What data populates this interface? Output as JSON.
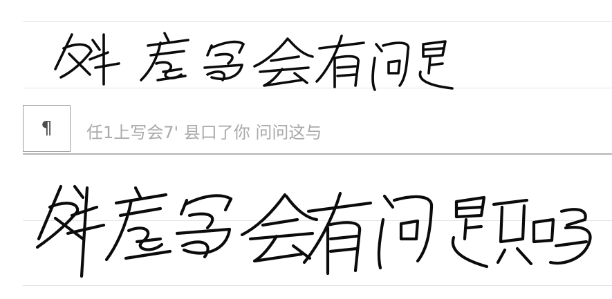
{
  "editor": {
    "ink_color": "#0b0b0b",
    "rule_color": "#e3e3e3",
    "handwriting_line_1": "斜着写会有问题",
    "handwriting_line_2": "斜着写会有问题吗"
  },
  "recognition_bar": {
    "paragraph_icon": "pilcrow-icon",
    "paragraph_glyph": "¶",
    "candidate_text": "任1上写会7' 县口了你 问问这与",
    "text_color": "#a9a9a9"
  }
}
